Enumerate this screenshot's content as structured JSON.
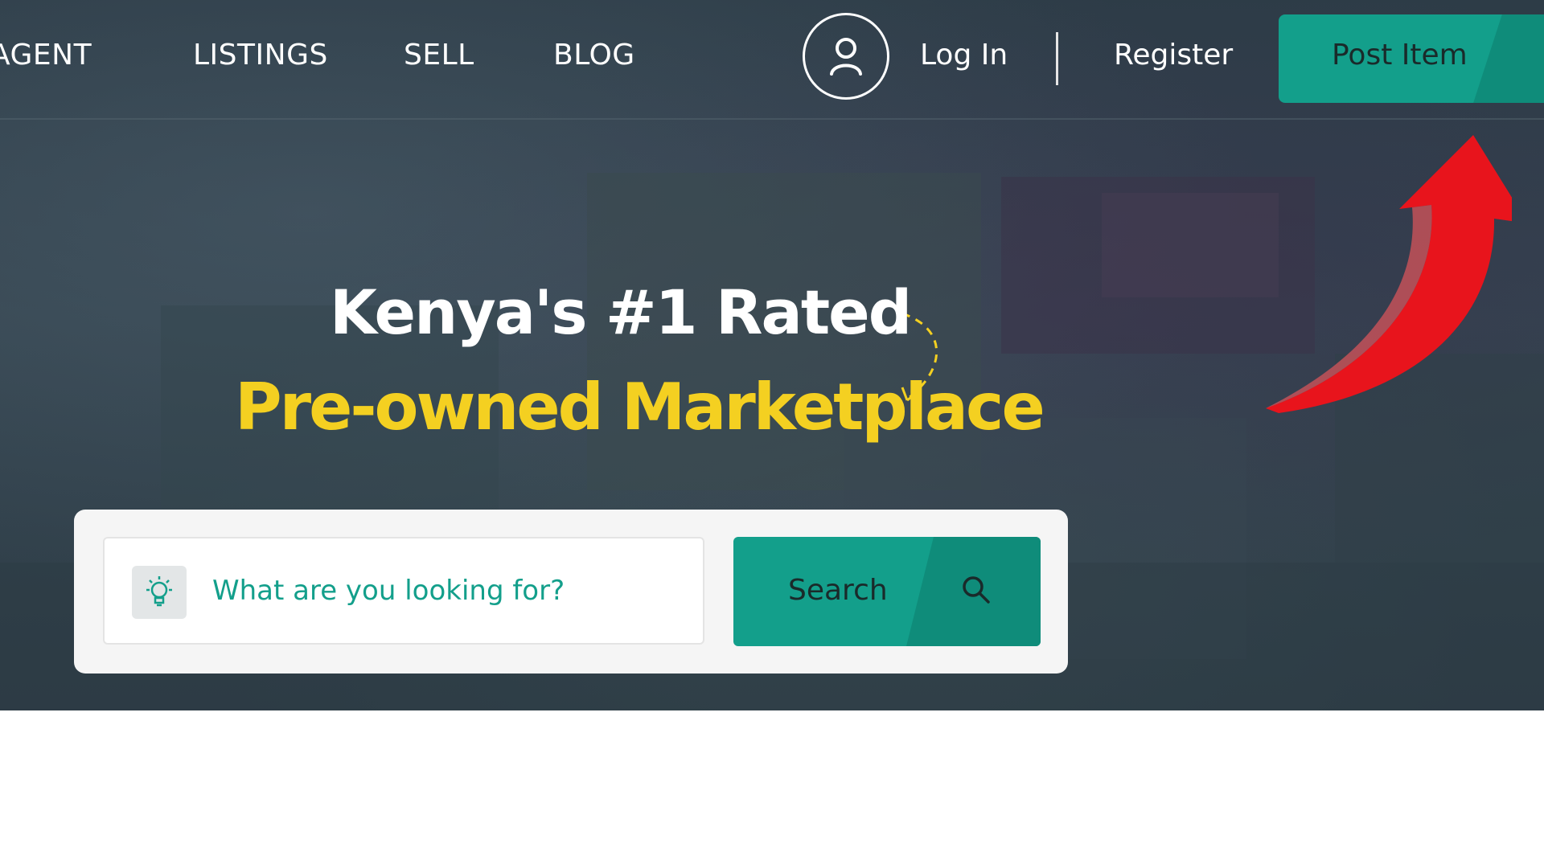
{
  "nav": {
    "items": [
      {
        "label": "AGENT"
      },
      {
        "label": "LISTINGS"
      },
      {
        "label": "SELL"
      },
      {
        "label": "BLOG"
      }
    ],
    "user_icon": "user-icon",
    "login_label": "Log In",
    "register_label": "Register",
    "post_item_label": "Post Item"
  },
  "hero": {
    "headline": "Kenya's #1 Rated",
    "subheadline": "Pre-owned Marketplace"
  },
  "search": {
    "placeholder": "What are you looking for?",
    "value": "",
    "button_label": "Search",
    "field_icon": "lightbulb-icon",
    "button_icon": "search-icon"
  },
  "annotation": {
    "arrow_icon": "red-arrow-icon"
  },
  "colors": {
    "accent": "#139f8b",
    "accent_dark": "#0f8c7a",
    "headline_yellow": "#f4d021",
    "arrow_red": "#e8141c"
  }
}
